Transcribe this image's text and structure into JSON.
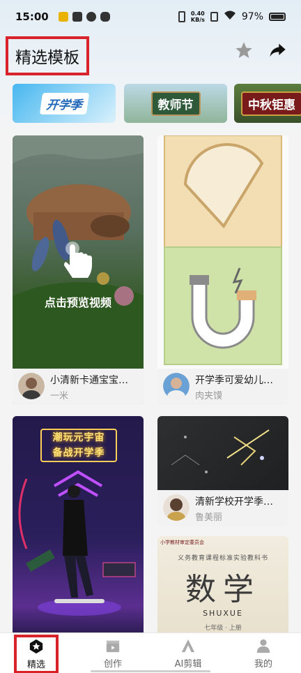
{
  "status_bar": {
    "time": "15:00",
    "speed_value": "0.40",
    "speed_unit": "KB/s",
    "battery": "97%"
  },
  "header": {
    "title": "精选模板"
  },
  "banners": [
    {
      "label": "开学季"
    },
    {
      "label": "教师节"
    },
    {
      "label": "中秋钜惠"
    }
  ],
  "cards": [
    {
      "title": "小清新卡通宝宝…",
      "author": "一米",
      "overlay": "点击预览视频"
    },
    {
      "title": "开学季可爱幼儿…",
      "author": "肉夹馍"
    },
    {
      "neon_line1": "潮玩元宇宙",
      "neon_line2": "备战开学季"
    },
    {
      "title": "清新学校开学季…",
      "author": "鲁美丽"
    },
    {
      "small_text": "小学教材审定委员会",
      "subtitle": "义务教育课程标准实验教科书",
      "big_text": "数学",
      "latin": "SHUXUE",
      "grade": "七年级 · 上册"
    }
  ],
  "bottom_nav": [
    {
      "label": "精选",
      "icon": "star-hex-icon"
    },
    {
      "label": "创作",
      "icon": "clapperboard-icon"
    },
    {
      "label": "AI剪辑",
      "icon": "ai-icon"
    },
    {
      "label": "我的",
      "icon": "person-icon"
    }
  ],
  "colors": {
    "highlight_red": "#d8232a",
    "muted_text": "#9a9a9a"
  }
}
